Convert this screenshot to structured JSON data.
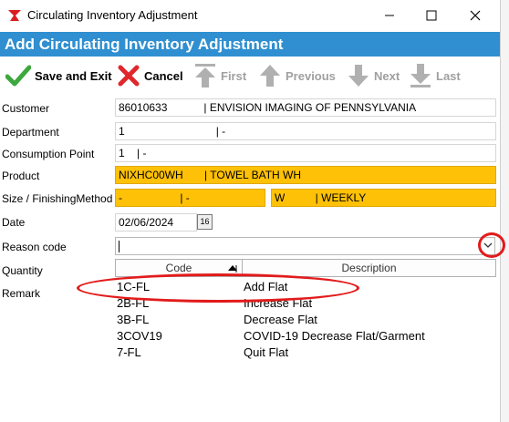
{
  "window": {
    "title": "Circulating Inventory Adjustment",
    "minimize": "—",
    "maximize": "☐",
    "close": "✕"
  },
  "header": {
    "title": "Add Circulating Inventory Adjustment"
  },
  "toolbar": {
    "save": "Save and Exit",
    "cancel": "Cancel",
    "first": "First",
    "previous": "Previous",
    "next": "Next",
    "last": "Last"
  },
  "fields": {
    "customer_label": "Customer",
    "customer_value": "86010633            | ENVISION IMAGING OF PENNSYLVANIA",
    "department_label": "Department",
    "department_value": "1                              | -",
    "consumption_label": "Consumption Point",
    "consumption_value": "1    | -",
    "product_label": "Product",
    "product_value": "NIXHC00WH       | TOWEL BATH WH",
    "size_label": "Size / FinishingMethod",
    "size_value": "-                   | -",
    "finishing_value": "W          | WEEKLY",
    "date_label": "Date",
    "date_value": "02/06/2024",
    "date_button": "16",
    "reason_label": "Reason code",
    "reason_value": "",
    "quantity_label": "Quantity",
    "remark_label": "Remark"
  },
  "dropdown": {
    "columns": [
      "Code",
      "Description"
    ],
    "rows": [
      {
        "code": "1C-FL",
        "description": "Add Flat"
      },
      {
        "code": "2B-FL",
        "description": "Increase Flat"
      },
      {
        "code": "3B-FL",
        "description": "Decrease Flat"
      },
      {
        "code": "3COV19",
        "description": "COVID-19 Decrease Flat/Garment"
      },
      {
        "code": "7-FL",
        "description": "Quit Flat"
      }
    ]
  },
  "colors": {
    "header_bg": "#2f8fd0",
    "highlight_yellow": "#ffc107",
    "annotation_red": "#e21b1b",
    "save_green": "#3da83d",
    "cancel_red": "#e0282c"
  }
}
